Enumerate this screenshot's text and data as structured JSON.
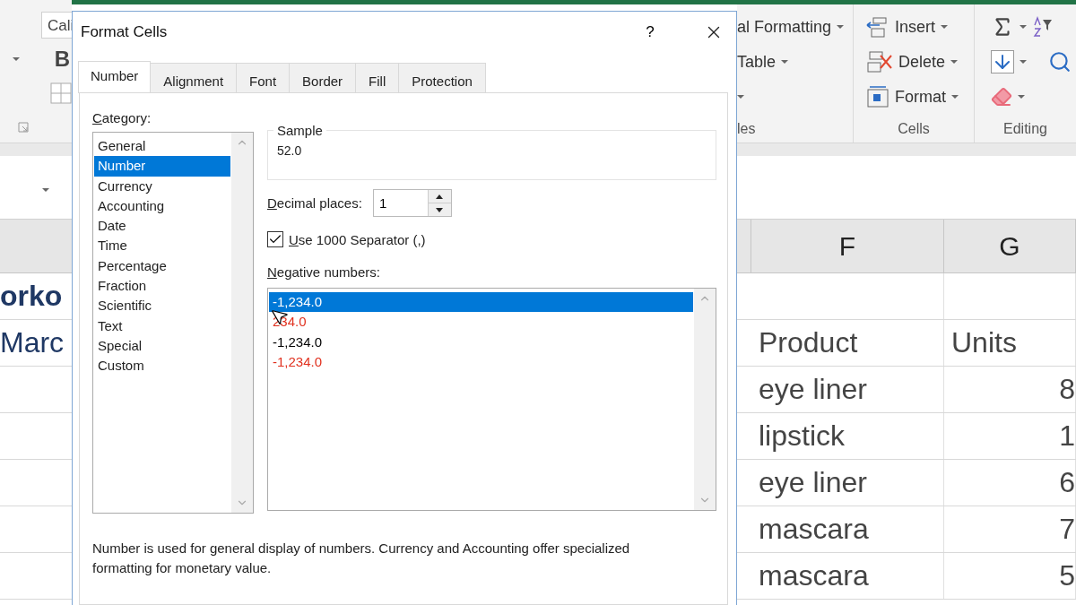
{
  "ribbon_left": {
    "font_box": "Cali",
    "bold_button": "B"
  },
  "ribbon_right": {
    "styles_items": [
      {
        "label": "al Formatting"
      },
      {
        "label": "Table"
      }
    ],
    "styles_caption": "les",
    "cells_items": [
      {
        "kind": "insert",
        "label": "Insert"
      },
      {
        "kind": "delete",
        "label": "Delete"
      },
      {
        "kind": "format",
        "label": "Format"
      }
    ],
    "cells_caption": "Cells",
    "editing_caption": "Editing"
  },
  "sheet_left": {
    "cells": [
      "orko",
      "Marc"
    ]
  },
  "sheet_right": {
    "column_headers": [
      "F",
      "G"
    ],
    "titles": {
      "product": "Product",
      "units": "Units"
    },
    "rows": [
      {
        "product": "eye liner",
        "units": "8"
      },
      {
        "product": "lipstick",
        "units": "1"
      },
      {
        "product": "eye liner",
        "units": "6"
      },
      {
        "product": "mascara",
        "units": "7"
      },
      {
        "product": "mascara",
        "units": "5"
      }
    ]
  },
  "dialog": {
    "title": "Format Cells",
    "help": "?",
    "tabs": [
      {
        "label": "Number",
        "selected": true
      },
      {
        "label": "Alignment",
        "selected": false
      },
      {
        "label": "Font",
        "selected": false
      },
      {
        "label": "Border",
        "selected": false
      },
      {
        "label": "Fill",
        "selected": false
      },
      {
        "label": "Protection",
        "selected": false
      }
    ],
    "category_label": {
      "text": "Category:"
    },
    "categories": [
      {
        "label": "General",
        "selected": false
      },
      {
        "label": "Number",
        "selected": true
      },
      {
        "label": "Currency",
        "selected": false
      },
      {
        "label": "Accounting",
        "selected": false
      },
      {
        "label": "Date",
        "selected": false
      },
      {
        "label": "Time",
        "selected": false
      },
      {
        "label": "Percentage",
        "selected": false
      },
      {
        "label": "Fraction",
        "selected": false
      },
      {
        "label": "Scientific",
        "selected": false
      },
      {
        "label": "Text",
        "selected": false
      },
      {
        "label": "Special",
        "selected": false
      },
      {
        "label": "Custom",
        "selected": false
      }
    ],
    "sample": {
      "label": "Sample",
      "value": "52.0"
    },
    "decimal_places": {
      "label": {
        "text": "Decimal places:"
      },
      "value": "1"
    },
    "separator": {
      "label": {
        "text": "Use 1000 Separator (,)"
      },
      "checked": true
    },
    "negative_label": {
      "text": "Negative numbers:"
    },
    "negative_numbers": [
      {
        "text": "-1,234.0",
        "selected": true
      },
      {
        "text": "234.0",
        "color": "#e0301e",
        "selected": false
      },
      {
        "text": "-1,234.0",
        "color": "#000000",
        "selected": false
      },
      {
        "text": "-1,234.0",
        "color": "#e0301e",
        "selected": false
      }
    ],
    "description": "Number is used for general display of numbers.  Currency and Accounting offer specialized formatting for monetary value."
  }
}
